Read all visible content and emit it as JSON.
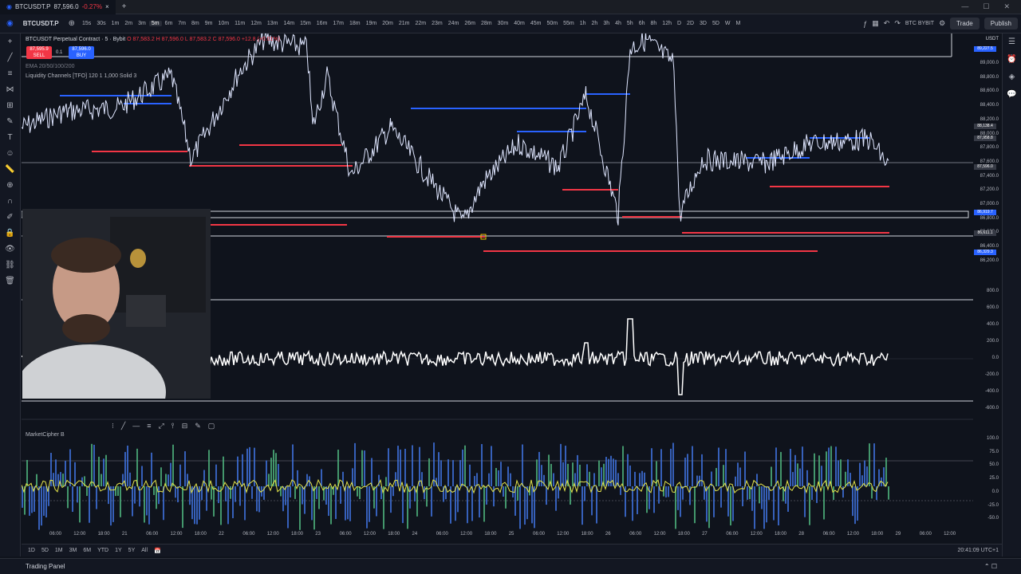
{
  "tab": {
    "title": "BTCUSDT.P",
    "price": "87,596.0",
    "change": "-0.27%"
  },
  "toolbar": {
    "symbol": "BTCUSDT.P",
    "timeframes": [
      "15s",
      "30s",
      "1m",
      "2m",
      "3m",
      "5m",
      "6m",
      "7m",
      "8m",
      "9m",
      "10m",
      "11m",
      "12m",
      "13m",
      "14m",
      "15m",
      "16m",
      "17m",
      "18m",
      "19m",
      "20m",
      "21m",
      "22m",
      "23m",
      "24m",
      "26m",
      "28m",
      "30m",
      "40m",
      "45m",
      "50m",
      "55m",
      "1h",
      "2h",
      "3h",
      "4h",
      "5h",
      "6h",
      "8h",
      "12h",
      "D",
      "2D",
      "3D",
      "5D",
      "W",
      "M"
    ],
    "active_timeframe": "5m",
    "broker": "BTC BYBIT",
    "trade_label": "Trade",
    "publish_label": "Publish"
  },
  "legend": {
    "symbol": "BTCUSDT Perpetual Contract · 5 · Bybit",
    "ohlc": "O 87,583.2 H 87,596.0 L 87,583.2 C 87,596.0 +12.8 (+0.01%)",
    "sell_price": "87,595.9",
    "sell_label": "SELL",
    "spread": "0.1",
    "buy_price": "87,596.0",
    "buy_label": "BUY",
    "ema": "EMA 20/50/100/200",
    "liquidity": "Liquidity Channels [TFO] 120 1 1,000 Solid 3",
    "marketcipher": "MarketCipher B"
  },
  "price_axis": {
    "currency": "USDT",
    "ticks": [
      "89,000.0",
      "88,800.0",
      "88,600.0",
      "88,400.0",
      "88,200.0",
      "88,000.0",
      "87,800.0",
      "87,600.0",
      "87,400.0",
      "87,200.0",
      "87,000.0",
      "86,800.0",
      "86,600.0",
      "86,400.0",
      "86,200.0"
    ],
    "tags": [
      {
        "v": "89,227.5",
        "color": "#2962ff"
      },
      {
        "v": "88,138.4",
        "color": "#363a45"
      },
      {
        "v": "87,958.8",
        "color": "#363a45"
      },
      {
        "v": "87,596.0",
        "color": "#363a45"
      },
      {
        "v": "86,919.7",
        "color": "#2962ff"
      },
      {
        "v": "86,611.1",
        "color": "#363a45"
      },
      {
        "v": "86,329.3",
        "color": "#2962ff"
      }
    ]
  },
  "osc_axis": {
    "ticks": [
      "800.0",
      "600.0",
      "400.0",
      "200.0",
      "0.0",
      "-200.0",
      "-400.0",
      "-600.0"
    ]
  },
  "mc_axis": {
    "ticks": [
      "100.0",
      "75.0",
      "50.0",
      "25.0",
      "0.0",
      "-25.0",
      "-50.0"
    ]
  },
  "time_axis": {
    "ticks": [
      "06:00",
      "12:00",
      "18:00",
      "21",
      "06:00",
      "12:00",
      "18:00",
      "22",
      "06:00",
      "12:00",
      "18:00",
      "23",
      "06:00",
      "12:00",
      "18:00",
      "24",
      "06:00",
      "12:00",
      "18:00",
      "25",
      "06:00",
      "12:00",
      "18:00",
      "26",
      "06:00",
      "12:00",
      "18:00",
      "27",
      "06:00",
      "12:00",
      "18:00",
      "28",
      "06:00",
      "12:00",
      "18:00",
      "29",
      "06:00",
      "12:00"
    ]
  },
  "bottom": {
    "ranges": [
      "1D",
      "5D",
      "1M",
      "3M",
      "6M",
      "YTD",
      "1Y",
      "5Y",
      "All"
    ],
    "clock": "20:41:09 UTC+1",
    "trading_panel": "Trading Panel"
  },
  "colors": {
    "bg": "#0f131c",
    "blue": "#2962ff",
    "red": "#f23645",
    "text": "#b2b5be"
  }
}
